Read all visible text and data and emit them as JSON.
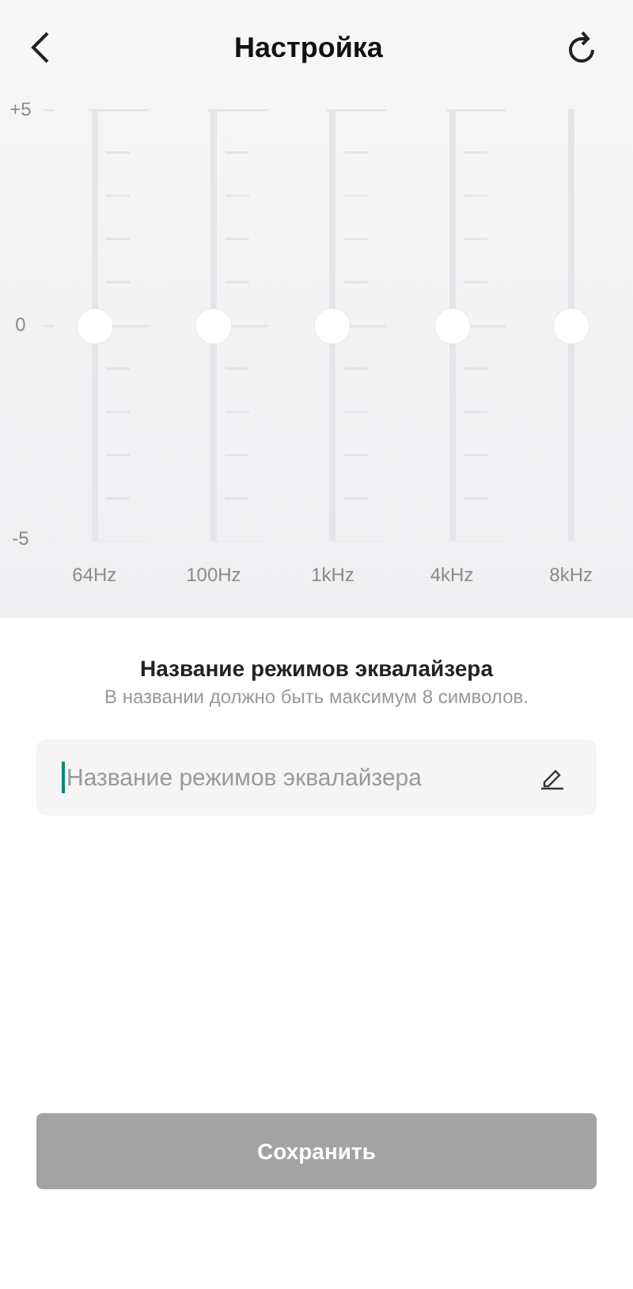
{
  "header": {
    "title": "Настройка"
  },
  "equalizer": {
    "scale": [
      "+5",
      "0",
      "-5"
    ],
    "bands": [
      {
        "label": "64Hz",
        "level": 0.5
      },
      {
        "label": "100Hz",
        "level": 0.5
      },
      {
        "label": "1kHz",
        "level": 0.5
      },
      {
        "label": "4kHz",
        "level": 0.5
      },
      {
        "label": "8kHz",
        "level": 0.5
      }
    ]
  },
  "name_section": {
    "title": "Название режимов эквалайзера",
    "hint": "В названии должно быть максимум 8 символов.",
    "field": {
      "placeholder": "Название режимов эквалайзера"
    }
  },
  "save_button": {
    "label": "Сохранить",
    "disabled": true
  }
}
